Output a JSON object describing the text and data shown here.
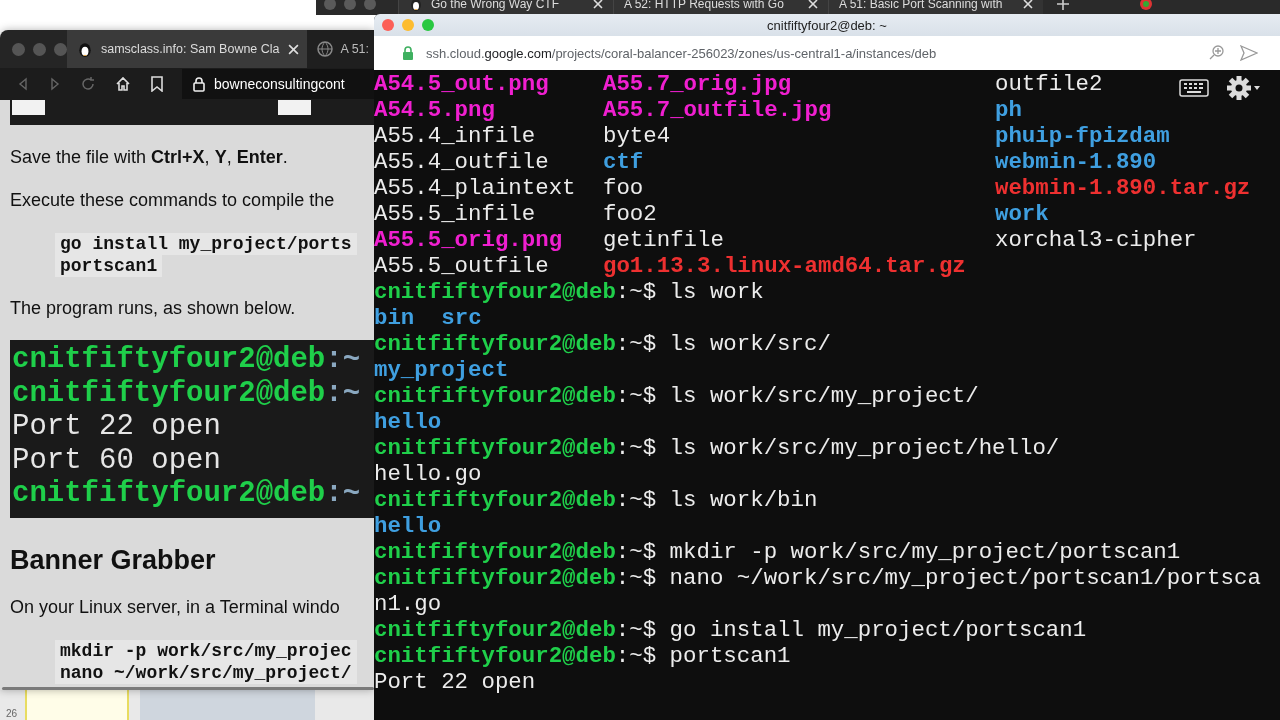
{
  "desktop": {
    "corner_number": "26"
  },
  "back_browser": {
    "tabs": [
      {
        "title": "Go the Wrong Way CTF"
      },
      {
        "title": "A 52: HTTP Requests with Go"
      },
      {
        "title": "A 51: Basic Port Scanning with"
      }
    ]
  },
  "left_browser": {
    "tabs": [
      {
        "title": "samsclass.info: Sam Bowne Cla",
        "selected": true
      },
      {
        "title": "A 51:",
        "selected": false
      }
    ],
    "url": "bowneconsultingcont",
    "content": [
      {
        "kind": "keys_strip"
      },
      {
        "kind": "paragraph",
        "text": "Save the file with **Ctrl+X**, **Y**, **Enter**."
      },
      {
        "kind": "paragraph",
        "text": "Execute these commands to compile the"
      },
      {
        "kind": "code",
        "lines": [
          "go install my_project/ports",
          "portscan1"
        ]
      },
      {
        "kind": "paragraph",
        "text": "The program runs, as shown below."
      },
      {
        "kind": "terminal_image",
        "lines": [
          {
            "kind": "prompt",
            "user": "cnitfiftyfour2@deb",
            "rest": ":~"
          },
          {
            "kind": "prompt",
            "user": "cnitfiftyfour2@deb",
            "rest": ":~"
          },
          {
            "kind": "output",
            "text": "Port 22 open"
          },
          {
            "kind": "output",
            "text": "Port 60 open"
          },
          {
            "kind": "prompt",
            "user": "cnitfiftyfour2@deb",
            "rest": ":~"
          }
        ]
      },
      {
        "kind": "heading",
        "text": "Banner Grabber"
      },
      {
        "kind": "paragraph",
        "text": "On your Linux server, in a Terminal windo"
      },
      {
        "kind": "code",
        "lines": [
          "mkdir -p work/src/my_projec",
          "nano ~/work/src/my_project/"
        ]
      }
    ]
  },
  "terminal": {
    "title": "cnitfiftyfour2@deb: ~",
    "url": {
      "subdomain": "ssh.cloud.",
      "domain": "google.com",
      "path": "/projects/coral-balancer-256023/zones/us-central1-a/instances/deb"
    },
    "listing": [
      [
        {
          "name": "A54.5_out.png",
          "kind": "image"
        },
        {
          "name": "A55.7_orig.jpg",
          "kind": "image"
        },
        {
          "name": "outfile2",
          "kind": "file"
        }
      ],
      [
        {
          "name": "A54.5.png",
          "kind": "image"
        },
        {
          "name": "A55.7_outfile.jpg",
          "kind": "image"
        },
        {
          "name": "ph",
          "kind": "dir"
        }
      ],
      [
        {
          "name": "A55.4_infile",
          "kind": "file"
        },
        {
          "name": "byte4",
          "kind": "file"
        },
        {
          "name": "phuip-fpizdam",
          "kind": "dir"
        }
      ],
      [
        {
          "name": "A55.4_outfile",
          "kind": "file"
        },
        {
          "name": "ctf",
          "kind": "dir"
        },
        {
          "name": "webmin-1.890",
          "kind": "dir"
        }
      ],
      [
        {
          "name": "A55.4_plaintext",
          "kind": "file"
        },
        {
          "name": "foo",
          "kind": "file"
        },
        {
          "name": "webmin-1.890.tar.gz",
          "kind": "archive"
        }
      ],
      [
        {
          "name": "A55.5_infile",
          "kind": "file"
        },
        {
          "name": "foo2",
          "kind": "file"
        },
        {
          "name": "work",
          "kind": "dir"
        }
      ],
      [
        {
          "name": "A55.5_orig.png",
          "kind": "image"
        },
        {
          "name": "getinfile",
          "kind": "file"
        },
        {
          "name": "xorchal3-cipher",
          "kind": "file"
        }
      ],
      [
        {
          "name": "A55.5_outfile",
          "kind": "file"
        },
        {
          "name": "go1.13.3.linux-amd64.tar.gz",
          "kind": "archive"
        }
      ]
    ],
    "lines": [
      {
        "kind": "prompt",
        "user": "cnitfiftyfour2@deb",
        "rest": ":~$ ",
        "command": "ls work"
      },
      {
        "kind": "output",
        "items": [
          {
            "name": "bin",
            "kind": "dir"
          },
          {
            "name": "src",
            "kind": "dir"
          }
        ]
      },
      {
        "kind": "prompt",
        "user": "cnitfiftyfour2@deb",
        "rest": ":~$ ",
        "command": "ls work/src/"
      },
      {
        "kind": "output",
        "items": [
          {
            "name": "my_project",
            "kind": "dir"
          }
        ]
      },
      {
        "kind": "prompt",
        "user": "cnitfiftyfour2@deb",
        "rest": ":~$ ",
        "command": "ls work/src/my_project/"
      },
      {
        "kind": "output",
        "items": [
          {
            "name": "hello",
            "kind": "dir"
          }
        ]
      },
      {
        "kind": "prompt",
        "user": "cnitfiftyfour2@deb",
        "rest": ":~$ ",
        "command": "ls work/src/my_project/hello/"
      },
      {
        "kind": "output",
        "items": [
          {
            "name": "hello.go",
            "kind": "file"
          }
        ]
      },
      {
        "kind": "prompt",
        "user": "cnitfiftyfour2@deb",
        "rest": ":~$ ",
        "command": "ls work/bin"
      },
      {
        "kind": "output",
        "items": [
          {
            "name": "hello",
            "kind": "dir"
          }
        ]
      },
      {
        "kind": "prompt",
        "user": "cnitfiftyfour2@deb",
        "rest": ":~$ ",
        "command": "mkdir -p work/src/my_project/portscan1"
      },
      {
        "kind": "prompt",
        "user": "cnitfiftyfour2@deb",
        "rest": ":~$ ",
        "command": "nano ~/work/src/my_project/portscan1/portsca"
      },
      {
        "kind": "output",
        "items": [
          {
            "name": "n1.go",
            "kind": "file"
          }
        ]
      },
      {
        "kind": "prompt",
        "user": "cnitfiftyfour2@deb",
        "rest": ":~$ ",
        "command": "go install my_project/portscan1"
      },
      {
        "kind": "prompt",
        "user": "cnitfiftyfour2@deb",
        "rest": ":~$ ",
        "command": "portscan1"
      },
      {
        "kind": "output",
        "items": [
          {
            "name": "Port 22 open",
            "kind": "file"
          }
        ]
      }
    ]
  }
}
